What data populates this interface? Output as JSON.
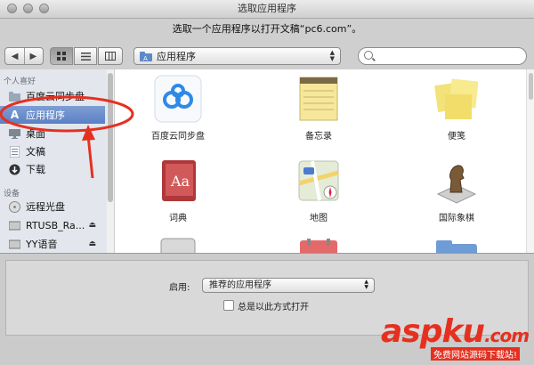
{
  "window": {
    "title": "选取应用程序"
  },
  "prompt": "选取一个应用程序以打开文稿“pc6.com”。",
  "toolbar": {
    "location": "应用程序",
    "search_placeholder": ""
  },
  "sidebar": {
    "favorites_header": "个人喜好",
    "favorites": [
      {
        "label": "百度云同步盘",
        "icon": "folder-icon"
      },
      {
        "label": "应用程序",
        "icon": "applications-icon",
        "selected": true
      },
      {
        "label": "桌面",
        "icon": "desktop-icon"
      },
      {
        "label": "文稿",
        "icon": "documents-icon"
      },
      {
        "label": "下载",
        "icon": "download-icon"
      }
    ],
    "devices_header": "设备",
    "devices": [
      {
        "label": "远程光盘",
        "icon": "disc-icon"
      },
      {
        "label": "RTUSB_Ra...",
        "icon": "drive-icon"
      },
      {
        "label": "YY语音",
        "icon": "drive-icon"
      }
    ]
  },
  "apps": [
    {
      "label": "百度云同步盘",
      "icon": "baidu-cloud-icon"
    },
    {
      "label": "备忘录",
      "icon": "notes-icon"
    },
    {
      "label": "便笺",
      "icon": "stickies-icon"
    },
    {
      "label": "词典",
      "icon": "dictionary-icon"
    },
    {
      "label": "地图",
      "icon": "maps-icon"
    },
    {
      "label": "国际象棋",
      "icon": "chess-icon"
    }
  ],
  "options": {
    "enable_label": "启用:",
    "enable_value": "推荐的应用程序",
    "always_open_label": "总是以此方式打开"
  },
  "watermark": {
    "main": "aspku",
    "suffix": ".com",
    "sub": "免费网站源码下载站!"
  },
  "colors": {
    "selection": "#6b8fcf",
    "annotation": "#e53020"
  }
}
